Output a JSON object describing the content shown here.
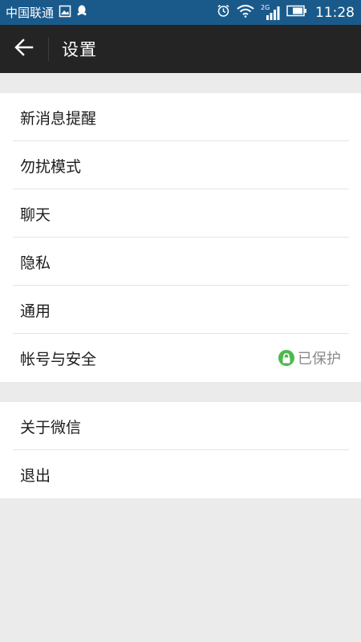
{
  "status_bar": {
    "carrier": "中国联通",
    "network": "2G",
    "time": "11:28",
    "icons": [
      "image-icon",
      "qq-icon",
      "alarm-icon",
      "wifi-icon",
      "signal-icon",
      "battery-icon"
    ]
  },
  "header": {
    "title": "设置",
    "back_icon": "arrow-left-icon"
  },
  "settings": {
    "group1": [
      {
        "label": "新消息提醒"
      },
      {
        "label": "勿扰模式"
      },
      {
        "label": "聊天"
      },
      {
        "label": "隐私"
      },
      {
        "label": "通用"
      },
      {
        "label": "帐号与安全",
        "status": "已保护",
        "status_icon": "lock-icon"
      }
    ],
    "group2": [
      {
        "label": "关于微信"
      },
      {
        "label": "退出"
      }
    ]
  },
  "colors": {
    "status_bar_bg": "#1a5a8b",
    "header_bg": "#242424",
    "page_bg": "#ebebeb",
    "protected_green": "#4cb94d"
  }
}
